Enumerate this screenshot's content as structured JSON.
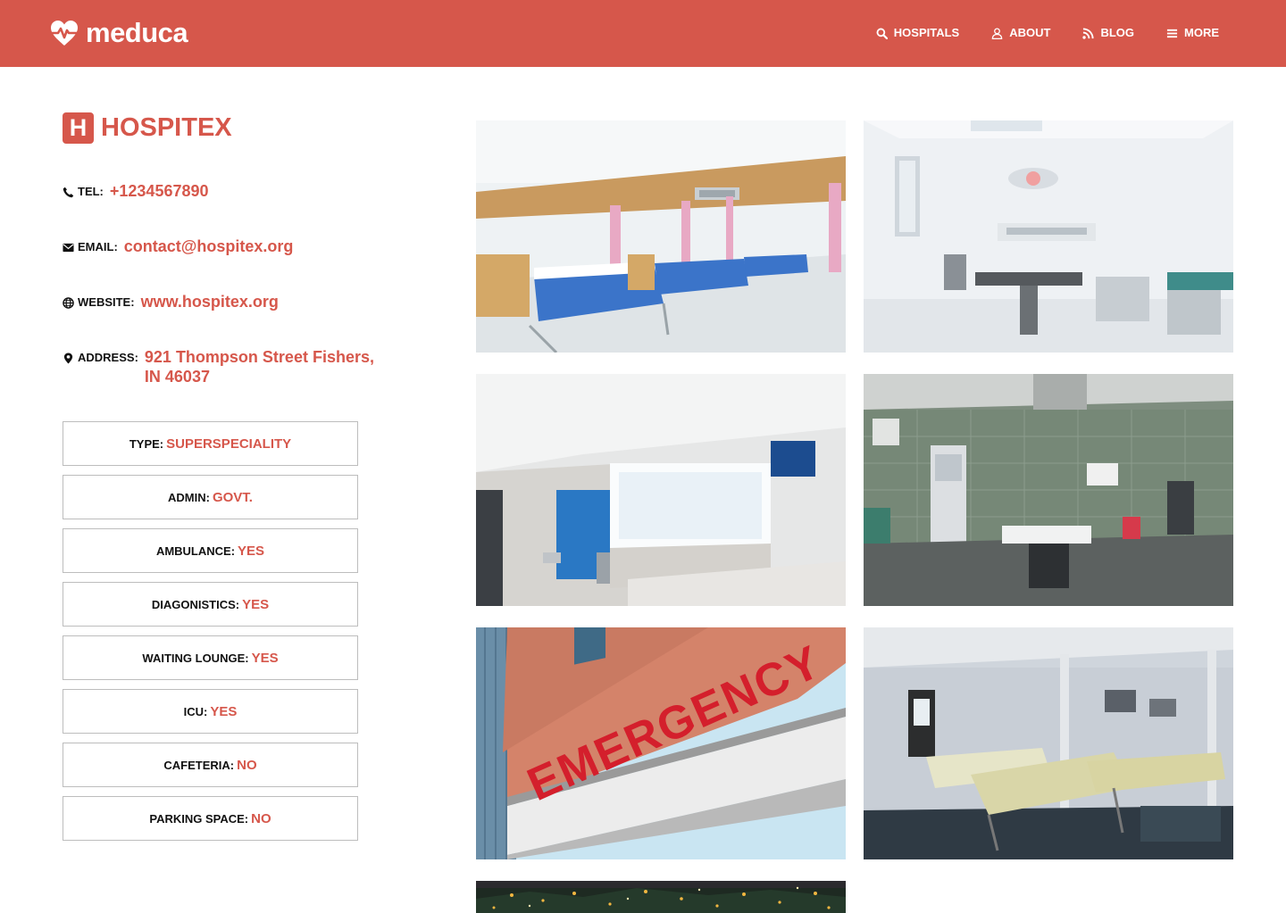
{
  "brand": {
    "name": "meduca",
    "icon": "heartbeat-icon"
  },
  "nav": [
    {
      "label": "HOSPITALS",
      "icon": "search-icon"
    },
    {
      "label": "ABOUT",
      "icon": "user-icon"
    },
    {
      "label": "BLOG",
      "icon": "rss-icon"
    },
    {
      "label": "MORE",
      "icon": "menu-icon"
    }
  ],
  "hospital": {
    "icon_letter": "H",
    "name": "HOSPITEX",
    "tel_label": "TEL:",
    "tel": "+1234567890",
    "email_label": "EMAIL:",
    "email": "contact@hospitex.org",
    "website_label": "WEBSITE:",
    "website": "www.hospitex.org",
    "address_label": "ADDRESS:",
    "address": "921 Thompson Street Fishers, IN 46037"
  },
  "features": [
    {
      "label": "TYPE:",
      "value": "SUPERSPECIALITY"
    },
    {
      "label": "ADMIN:",
      "value": "GOVT."
    },
    {
      "label": "AMBULANCE:",
      "value": "YES"
    },
    {
      "label": "DIAGONISTICS:",
      "value": "YES"
    },
    {
      "label": "WAITING LOUNGE:",
      "value": "YES"
    },
    {
      "label": "ICU:",
      "value": "YES"
    },
    {
      "label": "CAFETERIA:",
      "value": "NO"
    },
    {
      "label": "PARKING SPACE:",
      "value": "NO"
    }
  ],
  "gallery": {
    "emergency_sign": "EMERGENCY"
  },
  "colors": {
    "accent": "#d6574b",
    "text": "#111111",
    "border": "#bdbdbd"
  }
}
